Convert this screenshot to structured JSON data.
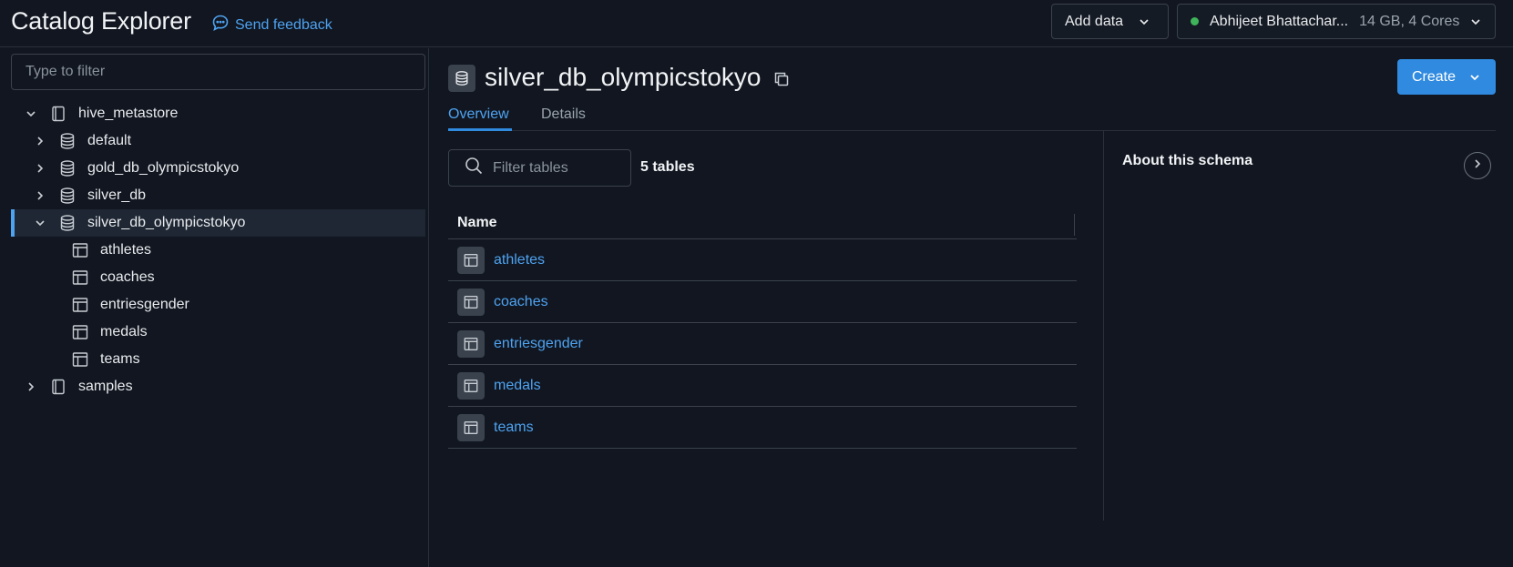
{
  "header": {
    "title": "Catalog Explorer",
    "feedback_label": "Send feedback",
    "add_data_label": "Add data",
    "cluster": {
      "name": "Abhijeet Bhattachar...",
      "specs": "14 GB, 4 Cores",
      "status_color": "#3fb45a"
    }
  },
  "sidebar": {
    "filter_placeholder": "Type to filter",
    "tree": {
      "catalog_hive": "hive_metastore",
      "schemas": [
        "default",
        "gold_db_olympicstokyo",
        "silver_db",
        "silver_db_olympicstokyo"
      ],
      "tables": [
        "athletes",
        "coaches",
        "entriesgender",
        "medals",
        "teams"
      ],
      "catalog_samples": "samples"
    }
  },
  "main": {
    "schema_name": "silver_db_olympicstokyo",
    "create_label": "Create",
    "tabs": [
      "Overview",
      "Details"
    ],
    "filter_placeholder": "Filter tables",
    "table_count": "5 tables",
    "table_header": "Name",
    "tables": [
      "athletes",
      "coaches",
      "entriesgender",
      "medals",
      "teams"
    ],
    "about_title": "About this schema"
  },
  "colors": {
    "background": "#111620",
    "accent": "#2f8ae0",
    "link": "#4ea3f1"
  }
}
